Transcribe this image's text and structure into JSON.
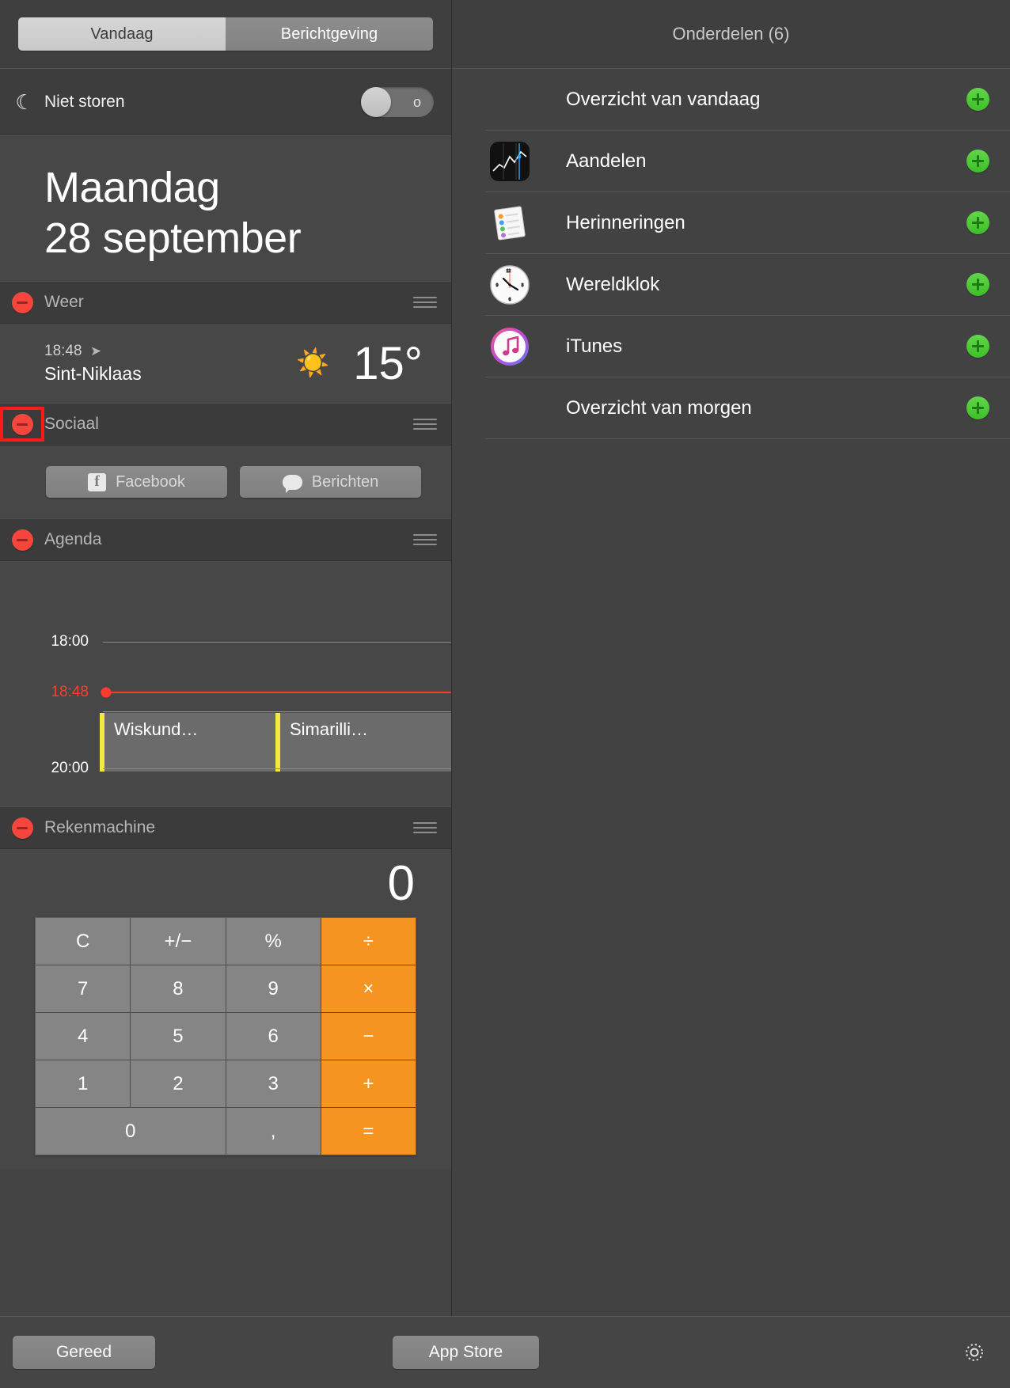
{
  "tabs": {
    "today_label": "Vandaag",
    "notifications_label": "Berichtgeving",
    "active": "Berichtgeving"
  },
  "do_not_disturb": {
    "label": "Niet storen",
    "icon": "moon-icon",
    "state": "off",
    "off_marker": "o"
  },
  "date": {
    "weekday": "Maandag",
    "day_month": "28 september"
  },
  "widgets": [
    {
      "title": "Weer",
      "remove_icon": "minus-icon",
      "grip_icon": "drag-handle-icon",
      "highlighted": false
    },
    {
      "title": "Sociaal",
      "remove_icon": "minus-icon",
      "grip_icon": "drag-handle-icon",
      "highlighted": true
    },
    {
      "title": "Agenda",
      "remove_icon": "minus-icon",
      "grip_icon": "drag-handle-icon",
      "highlighted": false
    },
    {
      "title": "Rekenmachine",
      "remove_icon": "minus-icon",
      "grip_icon": "drag-handle-icon",
      "highlighted": false
    }
  ],
  "weather": {
    "time": "18:48",
    "location_icon": "location-arrow-icon",
    "city": "Sint-Niklaas",
    "condition_icon": "sun-icon",
    "temperature": "15°"
  },
  "social": {
    "facebook_label": "Facebook",
    "facebook_icon": "facebook-icon",
    "messages_label": "Berichten",
    "messages_icon": "message-bubble-icon"
  },
  "calendar": {
    "hour_top": "18:00",
    "hour_bottom": "20:00",
    "now_time": "18:48",
    "now_color": "#ff3b30",
    "event_color": "#f5e93f",
    "events": [
      {
        "title": "Wiskund…"
      },
      {
        "title": "Simarilli…"
      }
    ]
  },
  "calculator": {
    "display": "0",
    "operator_color": "#f69422",
    "keys": [
      {
        "label": "C",
        "type": "fn"
      },
      {
        "label": "+/−",
        "type": "fn"
      },
      {
        "label": "%",
        "type": "fn"
      },
      {
        "label": "÷",
        "type": "op"
      },
      {
        "label": "7",
        "type": "num"
      },
      {
        "label": "8",
        "type": "num"
      },
      {
        "label": "9",
        "type": "num"
      },
      {
        "label": "×",
        "type": "op"
      },
      {
        "label": "4",
        "type": "num"
      },
      {
        "label": "5",
        "type": "num"
      },
      {
        "label": "6",
        "type": "num"
      },
      {
        "label": "−",
        "type": "op"
      },
      {
        "label": "1",
        "type": "num"
      },
      {
        "label": "2",
        "type": "num"
      },
      {
        "label": "3",
        "type": "num"
      },
      {
        "label": "+",
        "type": "op"
      },
      {
        "label": "0",
        "type": "num-wide"
      },
      {
        "label": ",",
        "type": "num"
      },
      {
        "label": "=",
        "type": "op"
      }
    ]
  },
  "right_panel": {
    "header": "Onderdelen (6)",
    "items": [
      {
        "label": "Overzicht van vandaag",
        "icon": "none",
        "add_icon": "plus-icon"
      },
      {
        "label": "Aandelen",
        "icon": "stocks-icon",
        "add_icon": "plus-icon"
      },
      {
        "label": "Herinneringen",
        "icon": "reminders-icon",
        "add_icon": "plus-icon"
      },
      {
        "label": "Wereldklok",
        "icon": "world-clock-icon",
        "add_icon": "plus-icon"
      },
      {
        "label": "iTunes",
        "icon": "itunes-icon",
        "add_icon": "plus-icon"
      },
      {
        "label": "Overzicht van morgen",
        "icon": "none",
        "add_icon": "plus-icon"
      }
    ]
  },
  "bottom_bar": {
    "done_label": "Gereed",
    "app_store_label": "App Store",
    "settings_icon": "gear-icon"
  }
}
